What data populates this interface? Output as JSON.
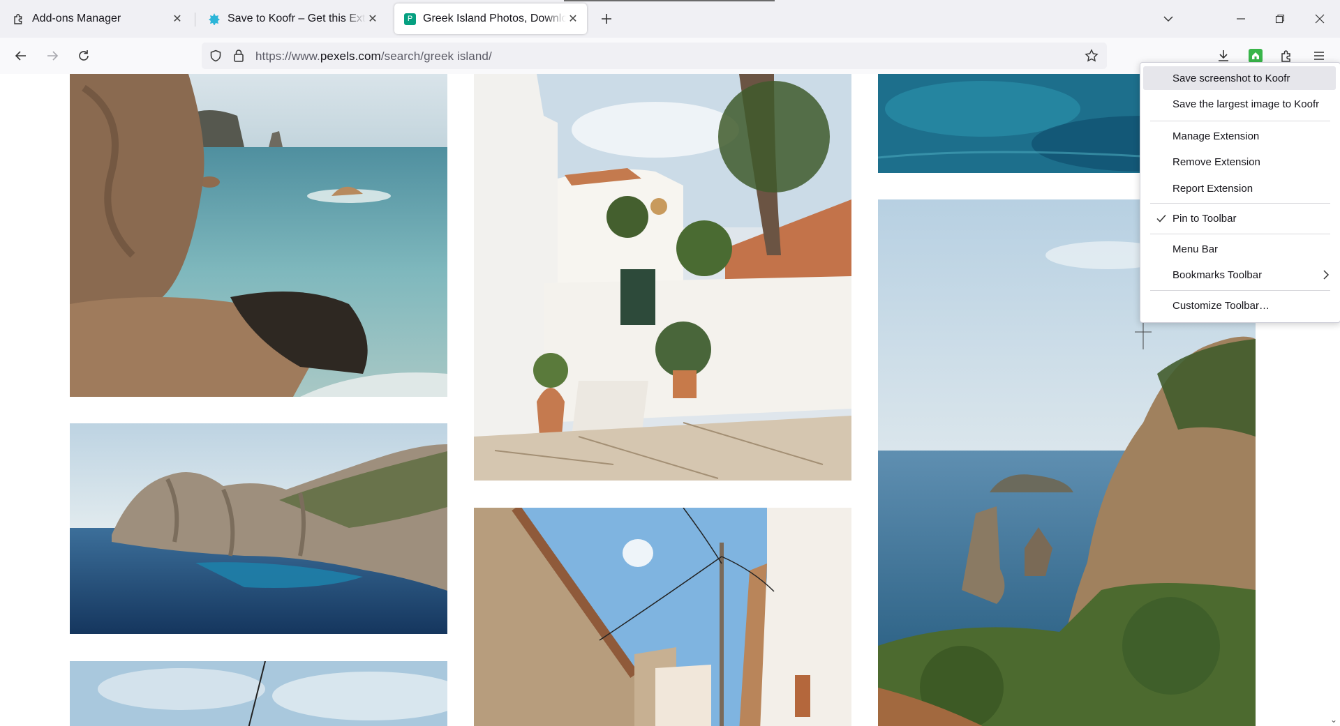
{
  "tabs": [
    {
      "title": "Add-ons Manager",
      "icon": "puzzle-icon"
    },
    {
      "title": "Save to Koofr – Get this Extension for Firefox",
      "icon": "koofr-icon"
    },
    {
      "title": "Greek Island Photos, Download The BEST Free Greek Island Stock Photos & HD Images",
      "icon": "pexels-icon",
      "active": true
    }
  ],
  "url": {
    "prefix": "https://www.",
    "domain": "pexels.com",
    "path": "/search/greek island/"
  },
  "context_menu": {
    "items": [
      {
        "label": "Save screenshot to Koofr",
        "hover": true
      },
      {
        "label": "Save the largest image to Koofr"
      },
      {
        "label": "Manage Extension"
      },
      {
        "label": "Remove Extension"
      },
      {
        "label": "Report Extension"
      },
      {
        "label": "Pin to Toolbar",
        "checked": true
      },
      {
        "label": "Menu Bar"
      },
      {
        "label": "Bookmarks Toolbar",
        "submenu": true
      },
      {
        "label": "Customize Toolbar…"
      }
    ]
  },
  "photos": [
    {
      "subject": "rocky coast with sea stacks"
    },
    {
      "subject": "white greek courtyard with potted plants"
    },
    {
      "subject": "turquoise sea from above"
    },
    {
      "subject": "limestone cliffs over blue bay"
    },
    {
      "subject": "sea cliffs with pine trees"
    },
    {
      "subject": "narrow village street with utility pole"
    },
    {
      "subject": "cloudy sky with cable"
    }
  ],
  "colors": {
    "accent": "#0061e0",
    "koofr": "#2cb5d8",
    "extension_green": "#39b54a"
  }
}
